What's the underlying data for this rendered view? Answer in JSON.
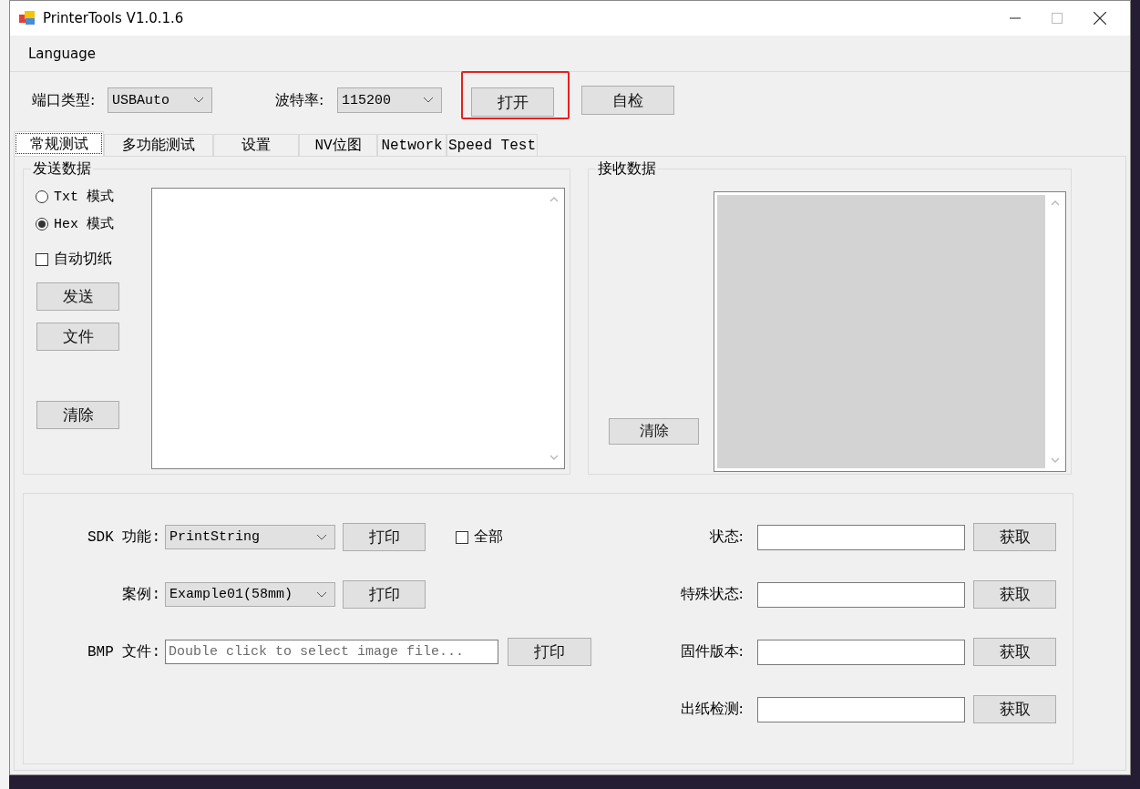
{
  "window": {
    "title": "PrinterTools V1.0.1.6"
  },
  "menu": [
    {
      "label": "Language"
    }
  ],
  "toolbar": {
    "port_type": {
      "label": "端口类型:",
      "value": "USBAuto"
    },
    "baud_rate": {
      "label": "波特率:",
      "value": "115200"
    },
    "buttons": [
      {
        "label": "打开",
        "highlighted": true
      },
      {
        "label": "自检",
        "highlighted": false
      }
    ]
  },
  "tabs": [
    {
      "label": "常规测试",
      "selected": true
    },
    {
      "label": "多功能测试",
      "selected": false
    },
    {
      "label": "设置",
      "selected": false
    },
    {
      "label": "NV位图",
      "selected": false
    },
    {
      "label": "Network",
      "selected": false
    },
    {
      "label": "Speed Test",
      "selected": false
    }
  ],
  "send_data": {
    "title": "发送数据",
    "modes": [
      {
        "label": "Txt 模式",
        "selected": false
      },
      {
        "label": "Hex 模式",
        "selected": true
      }
    ],
    "auto_cut": {
      "label": "自动切纸",
      "checked": false
    },
    "buttons": [
      "发送",
      "文件",
      "清除"
    ]
  },
  "receive_data": {
    "title": "接收数据",
    "clear_button": "清除"
  },
  "sdk": {
    "rows": [
      {
        "kind": "select",
        "label": "SDK 功能:",
        "value": "PrintString",
        "button": "打印"
      },
      {
        "kind": "select",
        "label": "案例:",
        "value": "Example01(58mm)",
        "button": "打印"
      },
      {
        "kind": "file",
        "label": "BMP 文件:",
        "placeholder": "Double click to select image file...",
        "button": "打印"
      }
    ],
    "all": {
      "label": "全部",
      "checked": false
    },
    "status_rows": [
      {
        "label": "状态:",
        "button": "获取"
      },
      {
        "label": "特殊状态:",
        "button": "获取"
      },
      {
        "label": "固件版本:",
        "button": "获取"
      },
      {
        "label": "出纸检测:",
        "button": "获取"
      }
    ]
  }
}
